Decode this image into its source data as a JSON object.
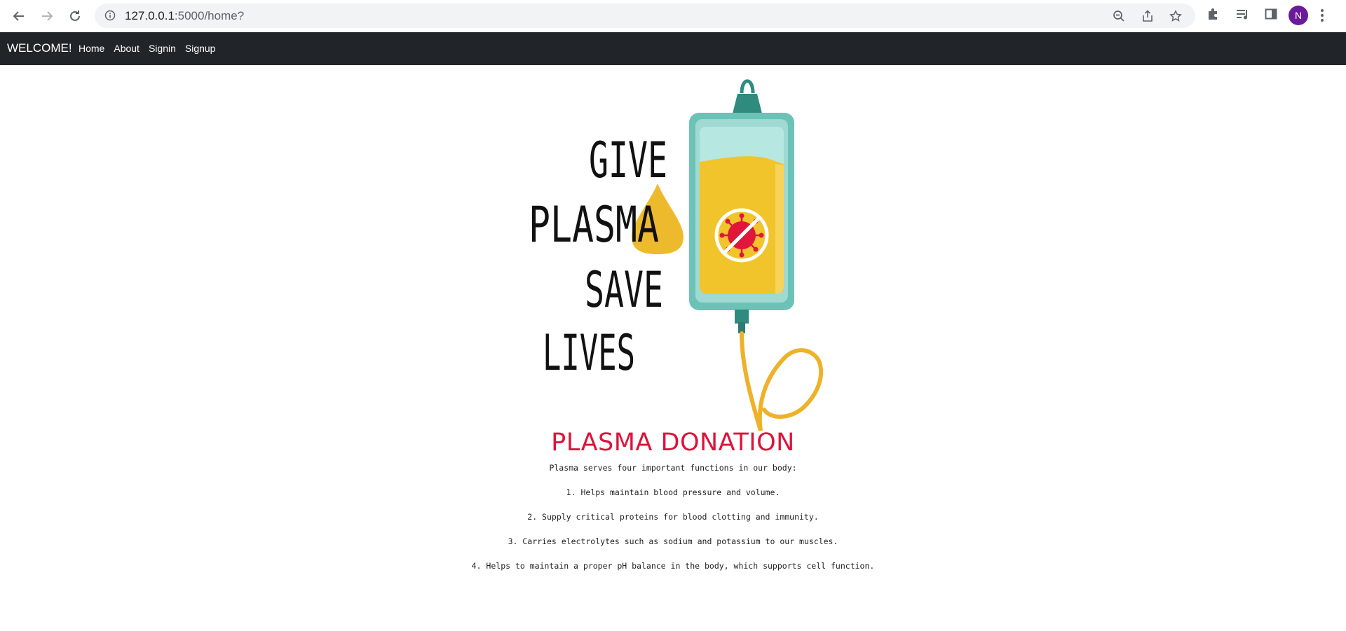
{
  "browser": {
    "url_host": "127.0.0.1",
    "url_rest": ":5000/home?",
    "profile_initial": "N"
  },
  "navbar": {
    "brand": "WELCOME!",
    "links": [
      "Home",
      "About",
      "Signin",
      "Signup"
    ]
  },
  "hero": {
    "lines": [
      "GIVE",
      "PLASMA",
      "SAVE",
      "LIVES"
    ]
  },
  "main": {
    "heading": "PLASMA DONATION",
    "intro": "Plasma serves four important functions in our body:",
    "items": [
      "1. Helps maintain blood pressure and volume.",
      "2. Supply critical proteins for blood clotting and immunity.",
      "3. Carries electrolytes such as sodium and potassium to our muscles.",
      "4. Helps to maintain a proper pH balance in the body, which supports cell function."
    ]
  },
  "colors": {
    "navbar_bg": "#212529",
    "heading": "#dc143c",
    "bag_teal": "#4aa89a",
    "plasma_yellow": "#f2c42c",
    "virus_red": "#e0173a"
  }
}
